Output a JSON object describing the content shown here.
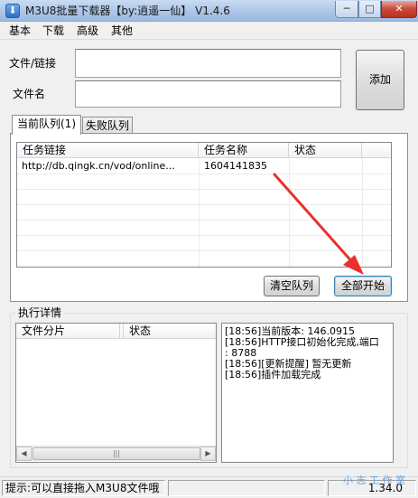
{
  "window": {
    "title": "M3U8批量下载器【by:逍遥一仙】 V1.4.6",
    "icon_glyph": "⬇",
    "minimize_glyph": "─",
    "maximize_glyph": "□",
    "close_glyph": "✕"
  },
  "menu": [
    "基本",
    "下载",
    "高级",
    "其他"
  ],
  "form": {
    "file_link_label": "文件/链接",
    "file_link_value": "",
    "file_name_label": "文件名",
    "file_name_value": "",
    "add_button": "添加"
  },
  "tabs": {
    "current_queue": "当前队列(1)",
    "failed_queue": "失败队列"
  },
  "task_list": {
    "columns": [
      "任务链接",
      "任务名称",
      "状态"
    ],
    "rows": [
      {
        "link": "http://db.qingk.cn/vod/online...",
        "name": "1604141835",
        "status": ""
      }
    ]
  },
  "buttons": {
    "clear_queue": "清空队列",
    "start_all": "全部开始"
  },
  "details": {
    "group_title": "执行详情",
    "segment_columns": [
      "文件分片",
      "状态"
    ],
    "log_lines": [
      "[18:56]当前版本: 146.0915",
      "[18:56]HTTP接口初始化完成,端口",
      ": 8788",
      "[18:56][更新提醒] 暂无更新",
      "[18:56]插件加载完成"
    ],
    "scroll_left": "◀",
    "scroll_right": "▶",
    "scroll_grip": "|||"
  },
  "status": {
    "tip": "提示:可以直接拖入M3U8文件哦",
    "version": "1.34.0",
    "watermark": "小 志 工 作 室"
  },
  "colors": {
    "arrow": "#e8312f"
  }
}
